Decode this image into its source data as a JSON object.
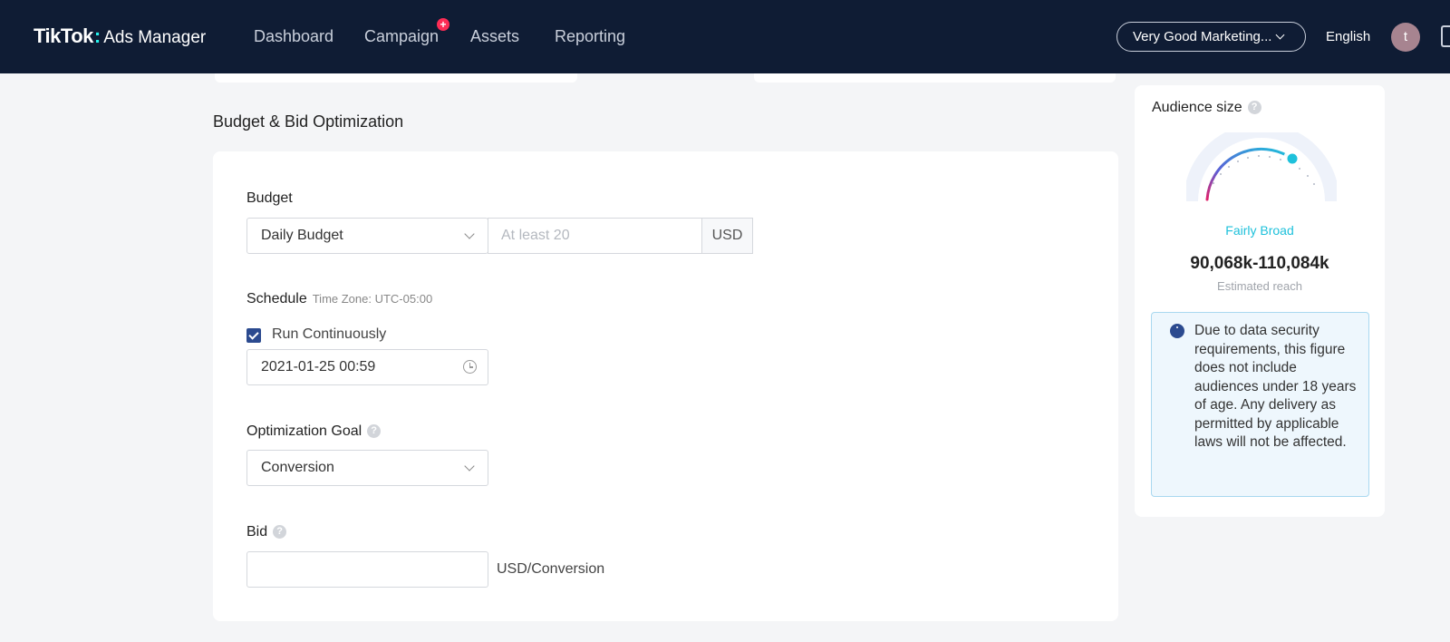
{
  "nav": {
    "logo_brand": "TikTok",
    "logo_product": "Ads Manager",
    "items": [
      "Dashboard",
      "Campaign",
      "Assets",
      "Reporting"
    ],
    "campaign_badge": "+",
    "account": "Very Good Marketing...",
    "language": "English",
    "avatar_initial": "t"
  },
  "section_title": "Budget & Bid Optimization",
  "budget": {
    "label": "Budget",
    "type": "Daily Budget",
    "placeholder": "At least 20",
    "currency": "USD"
  },
  "schedule": {
    "label": "Schedule",
    "timezone": "Time Zone: UTC-05:00",
    "run_continuously_label": "Run Continuously",
    "run_continuously_checked": true,
    "start_datetime": "2021-01-25 00:59"
  },
  "optimization": {
    "label": "Optimization Goal",
    "value": "Conversion"
  },
  "bid": {
    "label": "Bid",
    "value": "",
    "unit": "USD/Conversion"
  },
  "audience": {
    "title": "Audience size",
    "level": "Fairly Broad",
    "reach": "90,068k-110,084k",
    "reach_label": "Estimated reach",
    "note": "Due to data security requirements, this figure does not include audiences under 18 years of age. Any delivery as permitted by applicable laws will not be affected."
  },
  "colors": {
    "nav_bg": "#0f1c34",
    "accent": "#2b4a8f",
    "gauge_level": "#1ec1db",
    "badge": "#fe2c55"
  }
}
